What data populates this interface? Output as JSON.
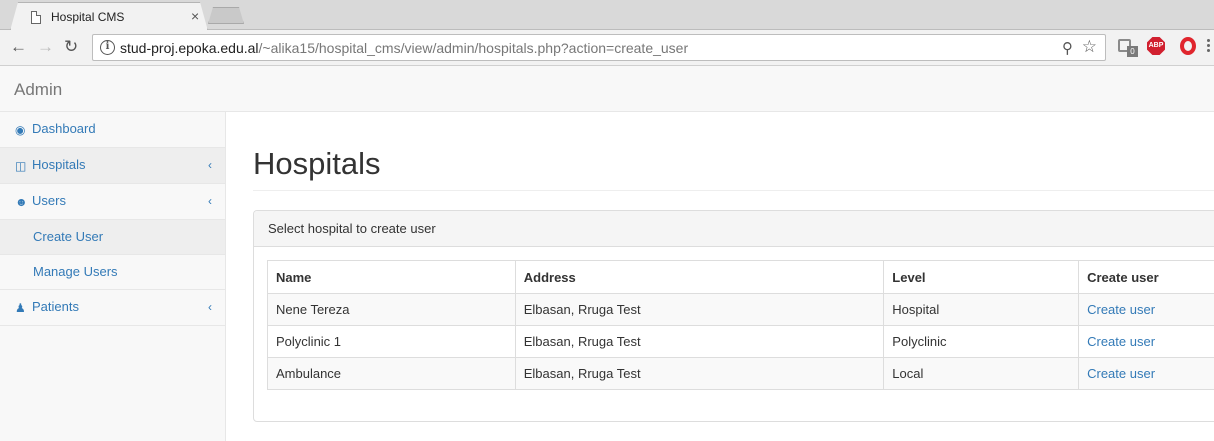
{
  "browser": {
    "tab_title": "Hospital CMS",
    "tab_close": "×",
    "url_host": "stud-proj.epoka.edu.al",
    "url_path": "/~alika15/hospital_cms/view/admin/hospitals.php?action=create_user",
    "extension_badge": "0",
    "adblock_label": "ABP"
  },
  "navbar": {
    "brand": "Admin"
  },
  "sidebar": {
    "items": [
      {
        "label": "Dashboard",
        "icon": "dashboard-icon"
      },
      {
        "label": "Hospitals",
        "icon": "hospital-icon",
        "arrow": "‹"
      },
      {
        "label": "Users",
        "icon": "user-icon",
        "arrow": "‹"
      },
      {
        "label": "Create User"
      },
      {
        "label": "Manage Users"
      },
      {
        "label": "Patients",
        "icon": "group-icon",
        "arrow": "‹"
      }
    ]
  },
  "main": {
    "title": "Hospitals",
    "panel_heading": "Select hospital to create user",
    "table": {
      "headers": [
        "Name",
        "Address",
        "Level",
        "Create user"
      ],
      "rows": [
        {
          "name": "Nene Tereza",
          "address": "Elbasan, Rruga Test",
          "level": "Hospital",
          "action": "Create user"
        },
        {
          "name": "Polyclinic 1",
          "address": "Elbasan, Rruga Test",
          "level": "Polyclinic",
          "action": "Create user"
        },
        {
          "name": "Ambulance",
          "address": "Elbasan, Rruga Test",
          "level": "Local",
          "action": "Create user"
        }
      ]
    }
  },
  "colors": {
    "link": "#337ab7",
    "sidebar_bg": "#f8f8f8",
    "active_bg": "#eeeeee",
    "border": "#dddddd",
    "abp_red": "#d1202f",
    "opera_red": "#e0252d"
  }
}
